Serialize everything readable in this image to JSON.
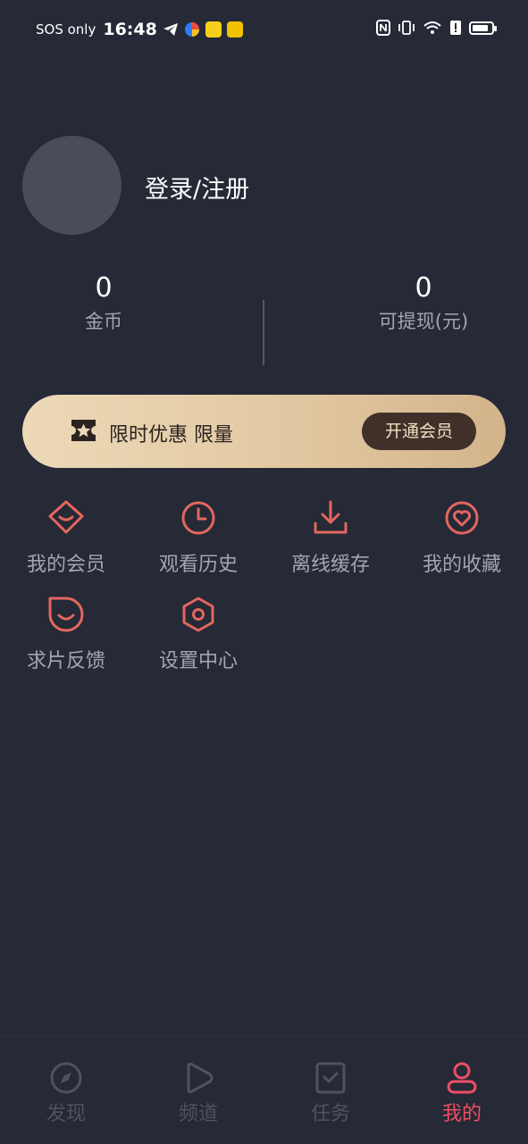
{
  "status_bar": {
    "carrier": "SOS only",
    "time": "16:48",
    "battery_level": 0.85
  },
  "profile": {
    "login_text": "登录/注册"
  },
  "stats": [
    {
      "value": "0",
      "label": "金币"
    },
    {
      "value": "0",
      "label": "可提现(元)"
    }
  ],
  "promo": {
    "text": "限时优惠 限量",
    "button_label": "开通会员",
    "icon": "ticket-star-icon"
  },
  "features": [
    {
      "label": "我的会员",
      "icon": "vip-diamond-icon"
    },
    {
      "label": "观看历史",
      "icon": "clock-icon"
    },
    {
      "label": "离线缓存",
      "icon": "download-icon"
    },
    {
      "label": "我的收藏",
      "icon": "heart-icon"
    },
    {
      "label": "求片反馈",
      "icon": "feedback-icon"
    },
    {
      "label": "设置中心",
      "icon": "settings-icon"
    }
  ],
  "nav": [
    {
      "label": "发现",
      "icon": "compass-icon",
      "active": false
    },
    {
      "label": "频道",
      "icon": "play-icon",
      "active": false
    },
    {
      "label": "任务",
      "icon": "task-icon",
      "active": false
    },
    {
      "label": "我的",
      "icon": "profile-icon",
      "active": true
    }
  ],
  "colors": {
    "background": "#262936",
    "accent": "#ee4f66",
    "icon_red": "#e3675f",
    "text_secondary": "#a4a6ae",
    "nav_inactive": "#4e5261",
    "promo_gold": "#e2c8a2",
    "promo_button": "#3f302a"
  }
}
